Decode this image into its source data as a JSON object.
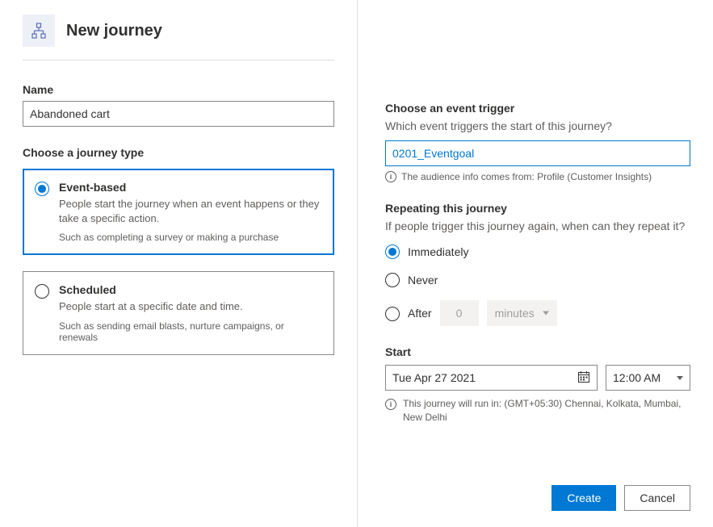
{
  "header": {
    "title": "New journey"
  },
  "name": {
    "label": "Name",
    "value": "Abandoned cart"
  },
  "journeyType": {
    "label": "Choose a journey type",
    "selected": "event-based",
    "options": {
      "eventBased": {
        "title": "Event-based",
        "desc": "People start the journey when an event happens or they take a specific action.",
        "example": "Such as completing a survey or making a purchase"
      },
      "scheduled": {
        "title": "Scheduled",
        "desc": "People start at a specific date and time.",
        "example": "Such as sending email blasts, nurture campaigns, or renewals"
      }
    }
  },
  "eventTrigger": {
    "label": "Choose an event trigger",
    "help": "Which event triggers the start of this journey?",
    "value": "0201_Eventgoal",
    "info": "The audience info comes from: Profile (Customer Insights)"
  },
  "repeating": {
    "label": "Repeating this journey",
    "help": "If people trigger this journey again, when can they repeat it?",
    "selected": "immediately",
    "options": {
      "immediately": "Immediately",
      "never": "Never",
      "after": "After"
    },
    "afterValue": "0",
    "afterUnit": "minutes"
  },
  "start": {
    "label": "Start",
    "date": "Tue Apr 27 2021",
    "time": "12:00 AM",
    "tzNote": "This journey will run in: (GMT+05:30) Chennai, Kolkata, Mumbai, New Delhi"
  },
  "footer": {
    "create": "Create",
    "cancel": "Cancel"
  }
}
